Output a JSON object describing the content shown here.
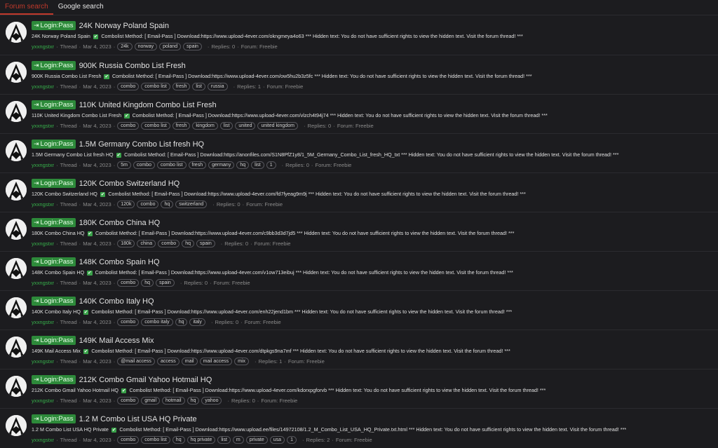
{
  "tabs": [
    {
      "label": "Forum search",
      "active": true
    },
    {
      "label": "Google search",
      "active": false
    }
  ],
  "separators": {
    "dot": "·",
    "thread": "Thread",
    "replies": "Replies:",
    "forum": "Forum:"
  },
  "results": [
    {
      "prefix": "Login:Pass",
      "title": "24K Norway Poland Spain",
      "snippet_a": "24K Norway Poland Spain",
      "snippet_b": "Combolist Method: [ Email-Pass ] Download:https://www.upload-4ever.com/okngmeya4o63 *** Hidden text: You do not have sufficient rights to view the hidden text. Visit the forum thread! ***",
      "author": "yxxngstxr",
      "date": "Mar 4, 2023",
      "tags": [
        "24k",
        "norway",
        "poland",
        "spain"
      ],
      "replies": "0",
      "forum": "Freebie"
    },
    {
      "prefix": "Login:Pass",
      "title": "900K Russia Combo List Fresh",
      "snippet_a": "900K Russia Combo List Fresh",
      "snippet_b": "Combolist Method: [ Email-Pass ] Download:https://www.upload-4ever.com/ow5hu2b3z5fc *** Hidden text: You do not have sufficient rights to view the hidden text. Visit the forum thread! ***",
      "author": "yxxngstxr",
      "date": "Mar 4, 2023",
      "tags": [
        "combo",
        "combo list",
        "fresh",
        "list",
        "russia"
      ],
      "replies": "1",
      "forum": "Freebie"
    },
    {
      "prefix": "Login:Pass",
      "title": "110K United Kingdom Combo List Fresh",
      "snippet_a": "110K United Kingdom Combo List Fresh",
      "snippet_b": "Combolist Method: [ Email-Pass ] Download:https://www.upload-4ever.com/vlzch4t94j74 *** Hidden text: You do not have sufficient rights to view the hidden text. Visit the forum thread! ***",
      "author": "yxxngstxr",
      "date": "Mar 4, 2023",
      "tags": [
        "combo",
        "combo list",
        "fresh",
        "kingdom",
        "list",
        "united",
        "united kingdom"
      ],
      "replies": "0",
      "forum": "Freebie"
    },
    {
      "prefix": "Login:Pass",
      "title": "1.5M Germany Combo List fresh HQ",
      "snippet_a": "1.5M Germany Combo List fresh HQ",
      "snippet_b": "Combolist Method: [ Email-Pass ] Download:https://anonfiles.com/S1N8PfZ1y8/1_5M_Germany_Combo_List_fresh_HQ_txt *** Hidden text: You do not have sufficient rights to view the hidden text. Visit the forum thread! ***",
      "author": "yxxngstxr",
      "date": "Mar 4, 2023",
      "tags": [
        "5m",
        "combo",
        "combo list",
        "fresh",
        "germany",
        "hq",
        "list",
        "1"
      ],
      "replies": "0",
      "forum": "Freebie"
    },
    {
      "prefix": "Login:Pass",
      "title": "120K Combo Switzerland HQ",
      "snippet_a": "120K Combo Switzerland HQ",
      "snippet_b": "Combolist Method: [ Email-Pass ] Download:https://www.upload-4ever.com/fd7fyeag9m9j *** Hidden text: You do not have sufficient rights to view the hidden text. Visit the forum thread! ***",
      "author": "yxxngstxr",
      "date": "Mar 4, 2023",
      "tags": [
        "120k",
        "combo",
        "hq",
        "switzerland"
      ],
      "replies": "0",
      "forum": "Freebie"
    },
    {
      "prefix": "Login:Pass",
      "title": "180K Combo China HQ",
      "snippet_a": "180K Combo China HQ",
      "snippet_b": "Combolist Method: [ Email-Pass ] Download:https://www.upload-4ever.com/c9bb3d3d7jd5 *** Hidden text: You do not have sufficient rights to view the hidden text. Visit the forum thread! ***",
      "author": "yxxngstxr",
      "date": "Mar 4, 2023",
      "tags": [
        "180k",
        "china",
        "combo",
        "hq",
        "spain"
      ],
      "replies": "0",
      "forum": "Freebie"
    },
    {
      "prefix": "Login:Pass",
      "title": "148K Combo Spain HQ",
      "snippet_a": "148K Combo Spain HQ",
      "snippet_b": "Combolist Method: [ Email-Pass ] Download:https://www.upload-4ever.com/v1ow713eibuj *** Hidden text: You do not have sufficient rights to view the hidden text. Visit the forum thread! ***",
      "author": "yxxngstxr",
      "date": "Mar 4, 2023",
      "tags": [
        "combo",
        "hq",
        "spain"
      ],
      "replies": "0",
      "forum": "Freebie"
    },
    {
      "prefix": "Login:Pass",
      "title": "140K Combo Italy HQ",
      "snippet_a": "140K Combo Italy HQ",
      "snippet_b": "Combolist Method: [ Email-Pass ] Download:https://www.upload-4ever.com/enh22jend1bm *** Hidden text: You do not have sufficient rights to view the hidden text. Visit the forum thread! ***",
      "author": "yxxngstxr",
      "date": "Mar 4, 2023",
      "tags": [
        "combo",
        "combo italy",
        "hq",
        "italy"
      ],
      "replies": "0",
      "forum": "Freebie"
    },
    {
      "prefix": "Login:Pass",
      "title": "149K Mail Access Mix",
      "snippet_a": "149K Mail Access Mix",
      "snippet_b": "Combolist Method: [ Email-Pass ] Download:https://www.upload-4ever.com/dtpkgs9na7mf *** Hidden text: You do not have sufficient rights to view the hidden text. Visit the forum thread! ***",
      "author": "yxxngstxr",
      "date": "Mar 4, 2023",
      "tags": [
        "@mail access",
        "access",
        "mail",
        "mail access",
        "mix"
      ],
      "replies": "1",
      "forum": "Freebie"
    },
    {
      "prefix": "Login:Pass",
      "title": "212K Combo Gmail Yahoo Hotmail HQ",
      "snippet_a": "212K Combo Gmail Yahoo Hotmail HQ",
      "snippet_b": "Combolist Method: [ Email-Pass ] Download:https://www.upload-4ever.com/kdorxpgforvb *** Hidden text: You do not have sufficient rights to view the hidden text. Visit the forum thread! ***",
      "author": "yxxngstxr",
      "date": "Mar 4, 2023",
      "tags": [
        "combo",
        "gmail",
        "hotmail",
        "hq",
        "yahoo"
      ],
      "replies": "0",
      "forum": "Freebie"
    },
    {
      "prefix": "Login:Pass",
      "title": "1.2 M Combo List USA HQ Private",
      "snippet_a": "1.2 M Combo List USA HQ Private",
      "snippet_b": "Combolist Method: [ Email-Pass ] Download:https://www.upload.ee/files/14972108/1.2_M_Combo_List_USA_HQ_Private.txt.html *** Hidden text: You do not have sufficient rights to view the hidden text. Visit the forum thread! ***",
      "author": "yxxngstxr",
      "date": "Mar 4, 2023",
      "tags": [
        "combo",
        "combo list",
        "hq",
        "hq private",
        "list",
        "m",
        "private",
        "usa",
        "1"
      ],
      "replies": "2",
      "forum": "Freebie"
    }
  ]
}
